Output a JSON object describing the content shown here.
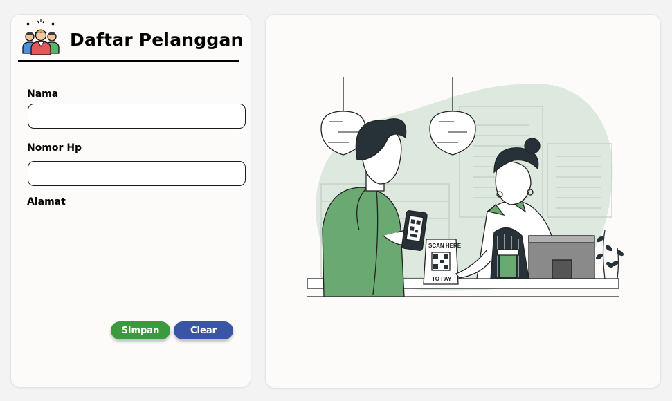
{
  "form": {
    "title": "Daftar Pelanggan",
    "logo_icon": "customer-group-icon",
    "fields": {
      "nama": {
        "label": "Nama",
        "value": "",
        "placeholder": ""
      },
      "nomor_hp": {
        "label": "Nomor Hp",
        "value": "",
        "placeholder": ""
      },
      "alamat": {
        "label": "Alamat"
      }
    },
    "buttons": {
      "save_label": "Simpan",
      "clear_label": "Clear"
    }
  },
  "illustration": {
    "sign_top": "SCAN HERE",
    "sign_bottom": "TO PAY"
  },
  "colors": {
    "save": "#3c9a3e",
    "clear": "#3a55a4",
    "accent_green": "#6aaa72",
    "blob": "#dde9df"
  }
}
